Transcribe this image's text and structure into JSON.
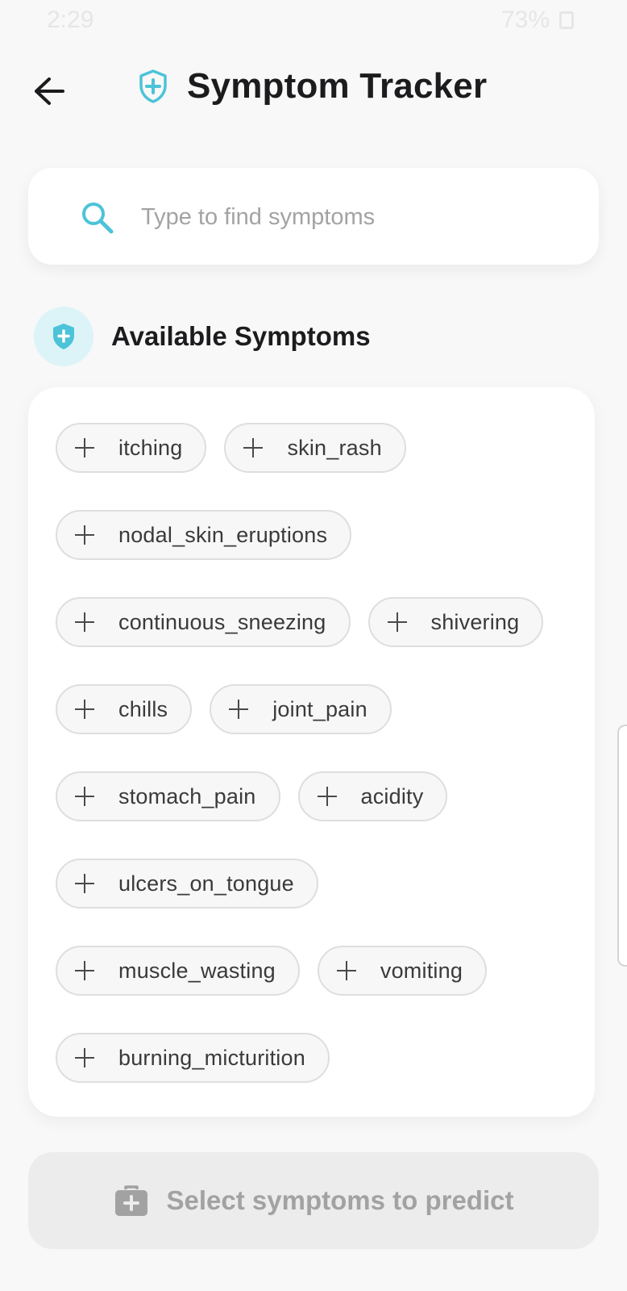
{
  "status_bar": {
    "time": "2:29",
    "battery": "73%"
  },
  "header": {
    "title": "Symptom Tracker",
    "back_icon": "arrow-left-icon",
    "title_icon": "shield-plus-icon"
  },
  "search": {
    "placeholder": "Type to find symptoms",
    "value": "",
    "icon": "search-icon"
  },
  "section": {
    "title": "Available Symptoms",
    "icon": "shield-plus-icon"
  },
  "symptoms": [
    [
      "itching",
      "skin_rash"
    ],
    [
      "nodal_skin_eruptions"
    ],
    [
      "continuous_sneezing",
      "shivering"
    ],
    [
      "chills",
      "joint_pain"
    ],
    [
      "stomach_pain",
      "acidity"
    ],
    [
      "ulcers_on_tongue"
    ],
    [
      "muscle_wasting",
      "vomiting"
    ],
    [
      "burning_micturition"
    ]
  ],
  "predict_button": {
    "label": "Select symptoms to predict",
    "icon": "medical-kit-icon",
    "enabled": false
  },
  "colors": {
    "accent": "#4cc3d9",
    "accent_light": "#dcf4f8",
    "disabled_bg": "#ececec",
    "disabled_text": "#a2a2a2"
  }
}
